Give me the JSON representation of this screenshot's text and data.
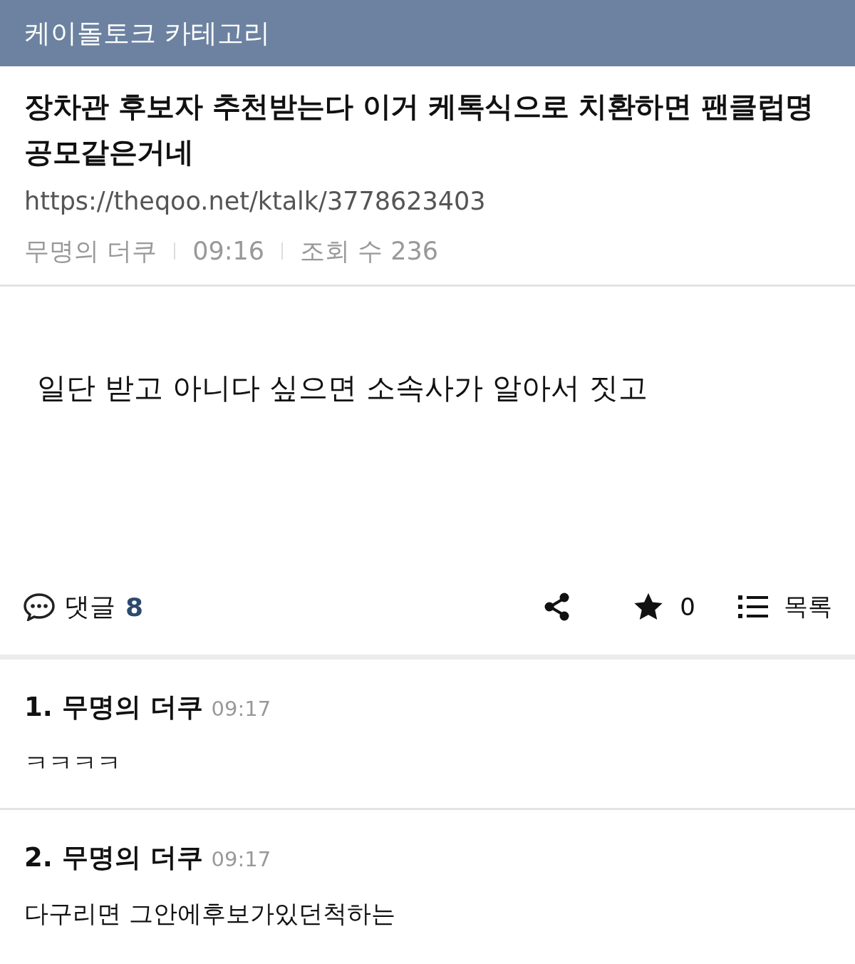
{
  "header": {
    "title": "케이돌토크 카테고리"
  },
  "post": {
    "title": "장차관 후보자 추천받는다 이거 케톡식으로 치환하면 팬클럽명 공모같은거네",
    "url": "https://theqoo.net/ktalk/3778623403",
    "author": "무명의 더쿠",
    "time": "09:16",
    "views": "조회 수 236",
    "body": "일단 받고 아니다 싶으면 소속사가 알아서 짓고"
  },
  "actions": {
    "comments_label": "댓글",
    "comments_count": "8",
    "stars_count": "0",
    "list_label": "목록"
  },
  "comments": [
    {
      "number": "1.",
      "author": "무명의 더쿠",
      "time": "09:17",
      "text": "ㅋㅋㅋㅋ"
    },
    {
      "number": "2.",
      "author": "무명의 더쿠",
      "time": "09:17",
      "text": "다구리면 그안에후보가있던척하는"
    }
  ]
}
